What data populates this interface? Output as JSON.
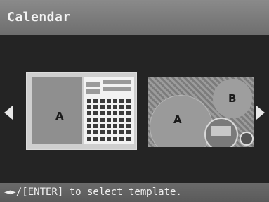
{
  "header": {
    "title": "Calendar"
  },
  "templates": [
    {
      "photo_label": "A",
      "selected": true
    },
    {
      "photo_labels": [
        "A",
        "B"
      ],
      "selected": false
    }
  ],
  "icons": {
    "left": "left-arrow-icon",
    "right": "right-arrow-icon"
  },
  "footer": {
    "hint": "◄►/[ENTER] to select template."
  }
}
